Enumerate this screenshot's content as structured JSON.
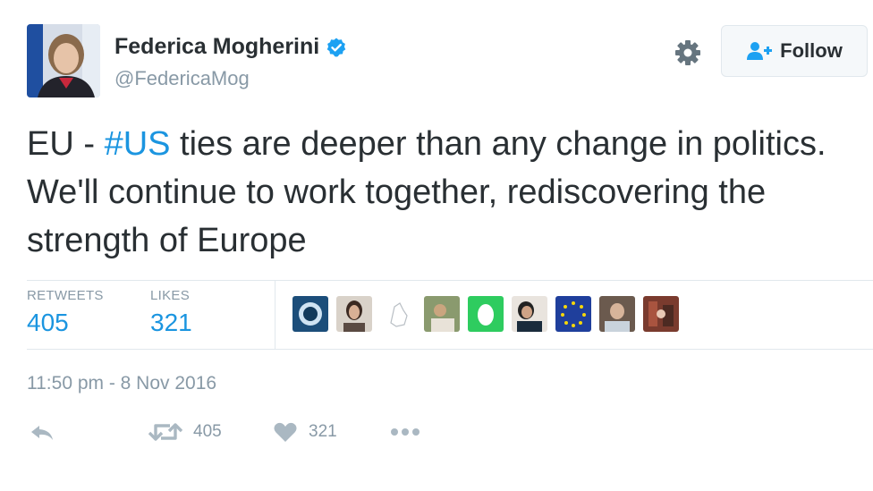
{
  "tweet": {
    "author_name": "Federica Mogherini",
    "handle": "@FedericaMog",
    "follow_label": "Follow",
    "text_before": "EU - ",
    "hashtag": "#US",
    "text_after": " ties are deeper than any change in politics. We'll continue to work together, rediscovering the strength of Europe",
    "timestamp": "11:50 pm - 8 Nov 2016"
  },
  "stats": {
    "retweets_label": "RETWEETS",
    "retweets_value": "405",
    "likes_label": "LIKES",
    "likes_value": "321"
  },
  "actions": {
    "retweet_count": "405",
    "like_count": "321"
  },
  "icons": [
    "verified-badge-icon",
    "gear-icon",
    "follow-person-icon",
    "reply-icon",
    "retweet-icon",
    "heart-icon",
    "more-icon"
  ],
  "colors": {
    "accent": "#1b95e0",
    "text": "#292f33",
    "muted": "#8899a6",
    "border": "#e1e8ed",
    "button_bg": "#f5f8fa"
  }
}
